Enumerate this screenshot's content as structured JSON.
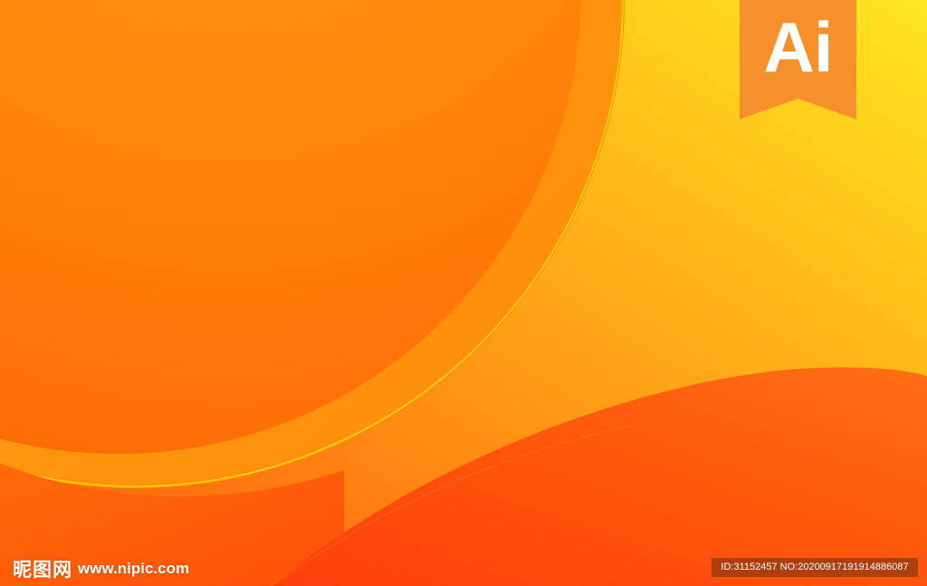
{
  "badge": {
    "text": "Ai"
  },
  "watermark": {
    "site_name": "昵图网",
    "site_url": "www.nipic.com",
    "image_info": "ID:31152457 NO:20200917191914886087"
  },
  "colors": {
    "top_right_yellow": "#ffe41e",
    "circle_orange": "#ff7e08",
    "wave_red_orange": "#ff4d0a",
    "badge_orange": "#f6902a",
    "accent_line": "#ffd60a"
  }
}
